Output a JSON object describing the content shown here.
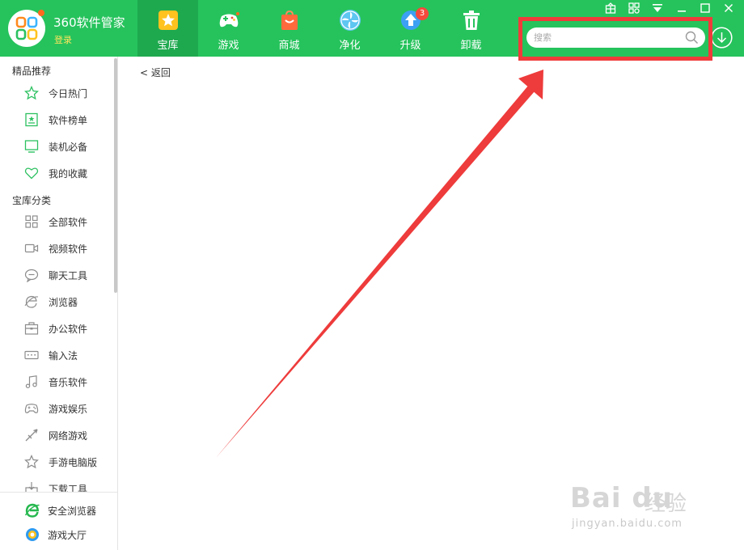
{
  "app": {
    "title": "360软件管家",
    "login_label": "登录"
  },
  "tabs": [
    {
      "label": "宝库",
      "active": true,
      "icon": "star-icon"
    },
    {
      "label": "游戏",
      "active": false,
      "icon": "gamepad-icon"
    },
    {
      "label": "商城",
      "active": false,
      "icon": "shopping-bag-icon"
    },
    {
      "label": "净化",
      "active": false,
      "icon": "fan-icon"
    },
    {
      "label": "升级",
      "active": false,
      "icon": "upgrade-arrow-icon",
      "badge": "3"
    },
    {
      "label": "卸载",
      "active": false,
      "icon": "trash-icon"
    }
  ],
  "window_controls": [
    "skin-icon",
    "settings-icon",
    "menu-icon",
    "minimize-icon",
    "maximize-icon",
    "close-icon"
  ],
  "search": {
    "placeholder": "搜索"
  },
  "sidebar": {
    "sections": [
      {
        "title": "精品推荐",
        "items": [
          {
            "label": "今日热门",
            "icon": "star-outline-icon"
          },
          {
            "label": "软件榜单",
            "icon": "ranking-icon"
          },
          {
            "label": "装机必备",
            "icon": "monitor-icon"
          },
          {
            "label": "我的收藏",
            "icon": "heart-icon"
          }
        ]
      },
      {
        "title": "宝库分类",
        "items": [
          {
            "label": "全部软件",
            "icon": "grid-icon"
          },
          {
            "label": "视频软件",
            "icon": "video-camera-icon"
          },
          {
            "label": "聊天工具",
            "icon": "chat-bubble-icon"
          },
          {
            "label": "浏览器",
            "icon": "browser-icon"
          },
          {
            "label": "办公软件",
            "icon": "briefcase-icon"
          },
          {
            "label": "输入法",
            "icon": "keyboard-icon"
          },
          {
            "label": "音乐软件",
            "icon": "music-note-icon"
          },
          {
            "label": "游戏娱乐",
            "icon": "gamepad-outline-icon"
          },
          {
            "label": "网络游戏",
            "icon": "sword-icon"
          },
          {
            "label": "手游电脑版",
            "icon": "star-outline-icon"
          },
          {
            "label": "下载工具",
            "icon": "download-tool-icon"
          }
        ]
      }
    ],
    "bottom": [
      {
        "label": "安全浏览器",
        "icon": "ie-browser-icon"
      },
      {
        "label": "游戏大厅",
        "icon": "game-hall-icon"
      }
    ]
  },
  "main": {
    "back_label": "< 返回"
  },
  "watermark": {
    "brand": "Bai du",
    "sub": "经验",
    "url": "jingyan.baidu.com"
  },
  "colors": {
    "topbar": "#26c35c",
    "active_tab": "#1ea94f",
    "highlight": "#f03b3b",
    "badge": "#f5493d",
    "sidebar_icon": "#2cc160"
  }
}
